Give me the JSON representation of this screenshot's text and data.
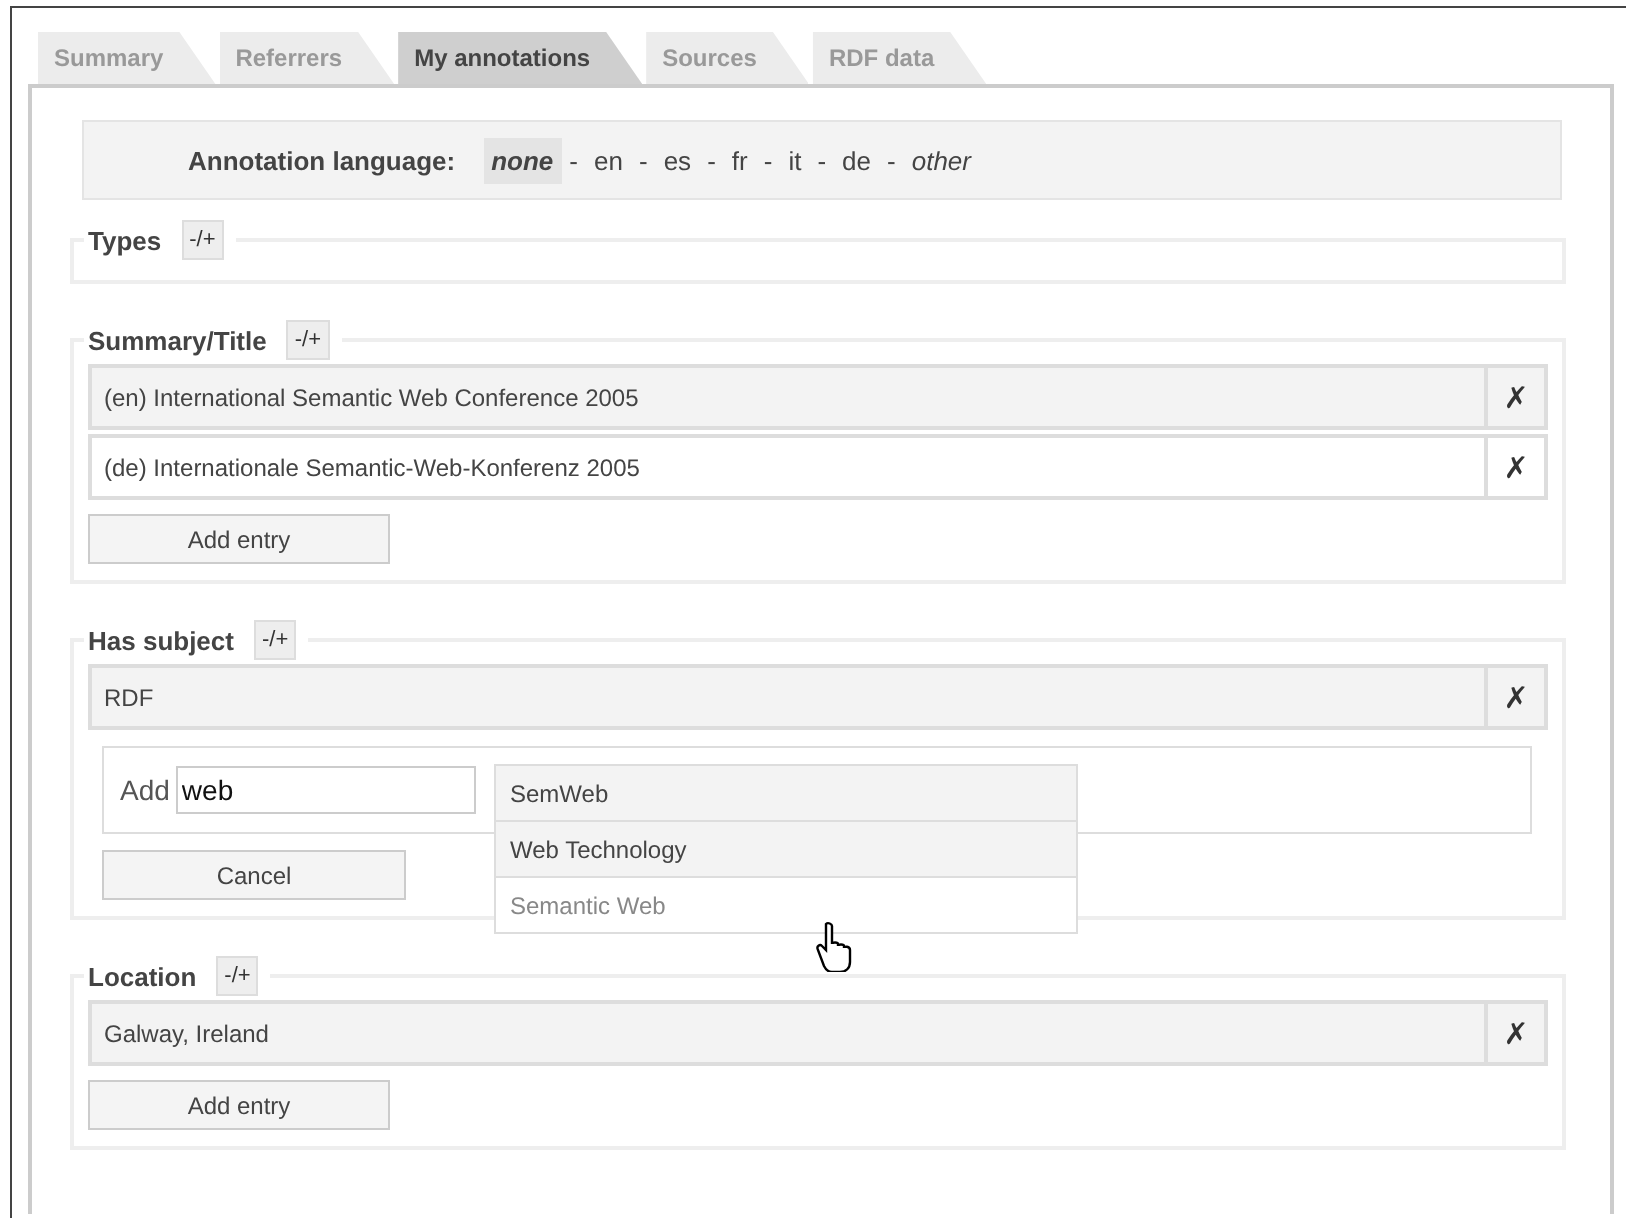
{
  "tabs": [
    {
      "label": "Summary",
      "selected": false
    },
    {
      "label": "Referrers",
      "selected": false
    },
    {
      "label": "My annotations",
      "selected": true
    },
    {
      "label": "Sources",
      "selected": false
    },
    {
      "label": "RDF data",
      "selected": false
    }
  ],
  "language": {
    "label": "Annotation language:",
    "separator": "-",
    "options": [
      {
        "label": "none",
        "selected": true,
        "kind": "empty"
      },
      {
        "label": "en",
        "selected": false,
        "kind": "code"
      },
      {
        "label": "es",
        "selected": false,
        "kind": "code"
      },
      {
        "label": "fr",
        "selected": false,
        "kind": "code"
      },
      {
        "label": "it",
        "selected": false,
        "kind": "code"
      },
      {
        "label": "de",
        "selected": false,
        "kind": "code"
      },
      {
        "label": "other",
        "selected": false,
        "kind": "custom"
      }
    ]
  },
  "sections": [
    {
      "title": "Types",
      "toggle": "-/+"
    },
    {
      "title": "Summary/Title",
      "toggle": "-/+",
      "entries": [
        {
          "text": "(en) International Semantic Web Conference 2005",
          "delete": "✗"
        },
        {
          "text": "(de) Internationale Semantic-Web-Konferenz 2005",
          "delete": "✗"
        }
      ],
      "add_button": "Add entry"
    },
    {
      "title": "Has subject",
      "toggle": "-/+",
      "entries": [
        {
          "text": "RDF",
          "delete": "✗"
        }
      ],
      "add_form": {
        "label": "Add",
        "value": "web",
        "cancel": "Cancel",
        "suggestions": [
          {
            "label": "SemWeb",
            "selected": false
          },
          {
            "label": "Web Technology",
            "selected": false
          },
          {
            "label": "Semantic Web",
            "selected": true
          }
        ]
      }
    },
    {
      "title": "Location",
      "toggle": "-/+",
      "entries": [
        {
          "text": "Galway, Ireland",
          "delete": "✗"
        }
      ],
      "add_button": "Add entry"
    }
  ]
}
